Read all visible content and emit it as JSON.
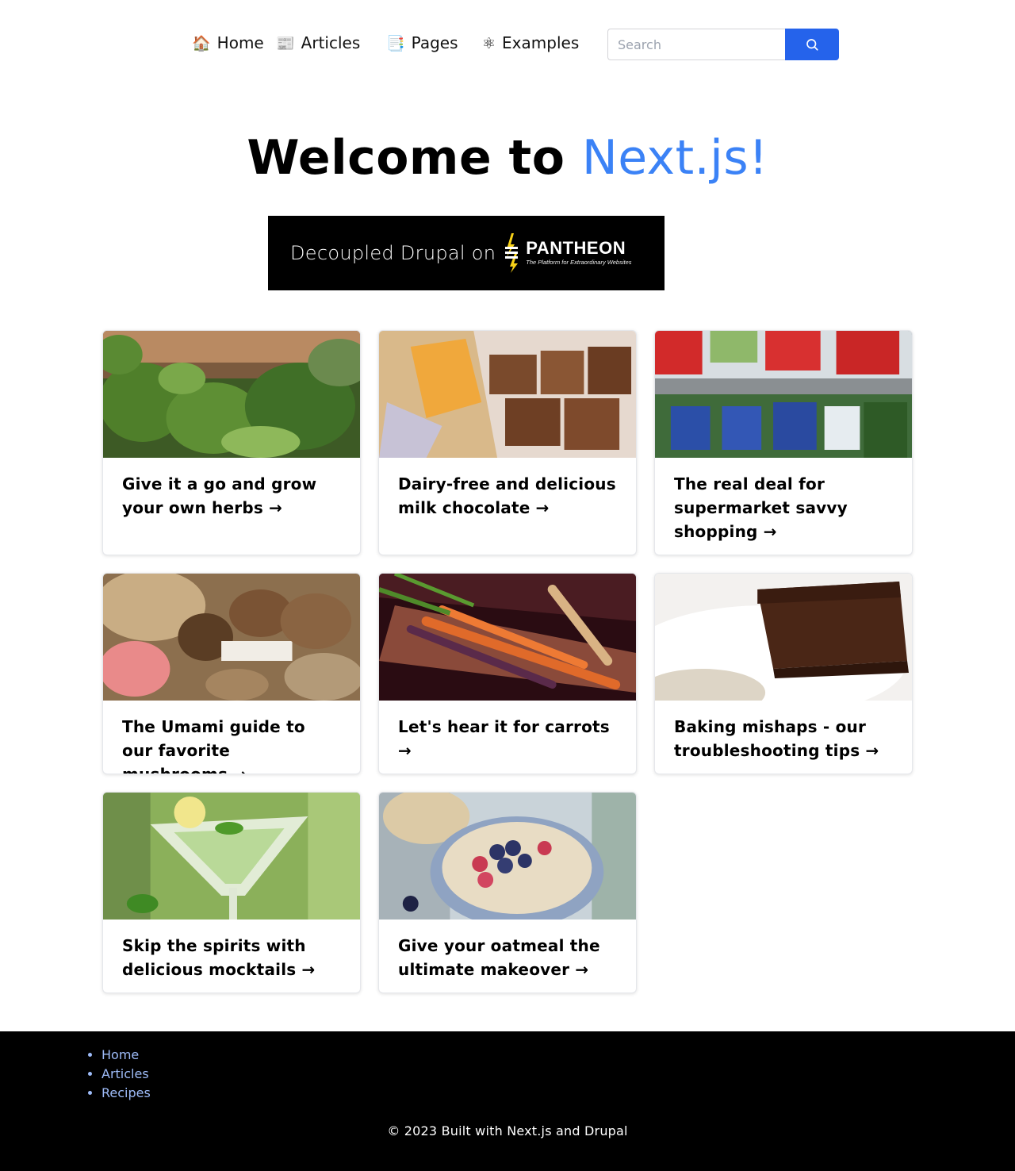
{
  "nav": {
    "items": [
      {
        "emoji": "🏠",
        "label": "Home"
      },
      {
        "emoji": "📰",
        "label": "Articles"
      },
      {
        "emoji": "📑",
        "label": "Pages"
      },
      {
        "emoji": "⚛",
        "label": "Examples"
      }
    ],
    "search_placeholder": "Search",
    "search_button_color": "#2563eb"
  },
  "hero": {
    "title_prefix": "Welcome to",
    "title_accent": "Next.js!",
    "accent_color": "#3b82f6"
  },
  "banner": {
    "text": "Decoupled Drupal on",
    "brand": "PANTHEON",
    "tagline": "The Platform for Extraordinary Websites"
  },
  "cards": [
    {
      "title": "Give it a go and grow your own herbs →",
      "image": "herbs-photo"
    },
    {
      "title": "Dairy-free and delicious milk chocolate →",
      "image": "chocolate-photo"
    },
    {
      "title": "The real deal for supermarket savvy shopping →",
      "image": "supermarket-photo"
    },
    {
      "title": "The Umami guide to our favorite mushrooms →",
      "image": "mushrooms-photo"
    },
    {
      "title": "Let's hear it for carrots →",
      "image": "carrots-photo"
    },
    {
      "title": "Baking mishaps - our troubleshooting tips →",
      "image": "brownie-photo"
    },
    {
      "title": "Skip the spirits with delicious mocktails →",
      "image": "mocktail-photo"
    },
    {
      "title": "Give your oatmeal the ultimate makeover →",
      "image": "oatmeal-photo"
    }
  ],
  "footer": {
    "links": [
      "Home",
      "Articles",
      "Recipes"
    ],
    "copyright": "© 2023 Built with Next.js and Drupal",
    "link_color": "#9ebcf9"
  }
}
